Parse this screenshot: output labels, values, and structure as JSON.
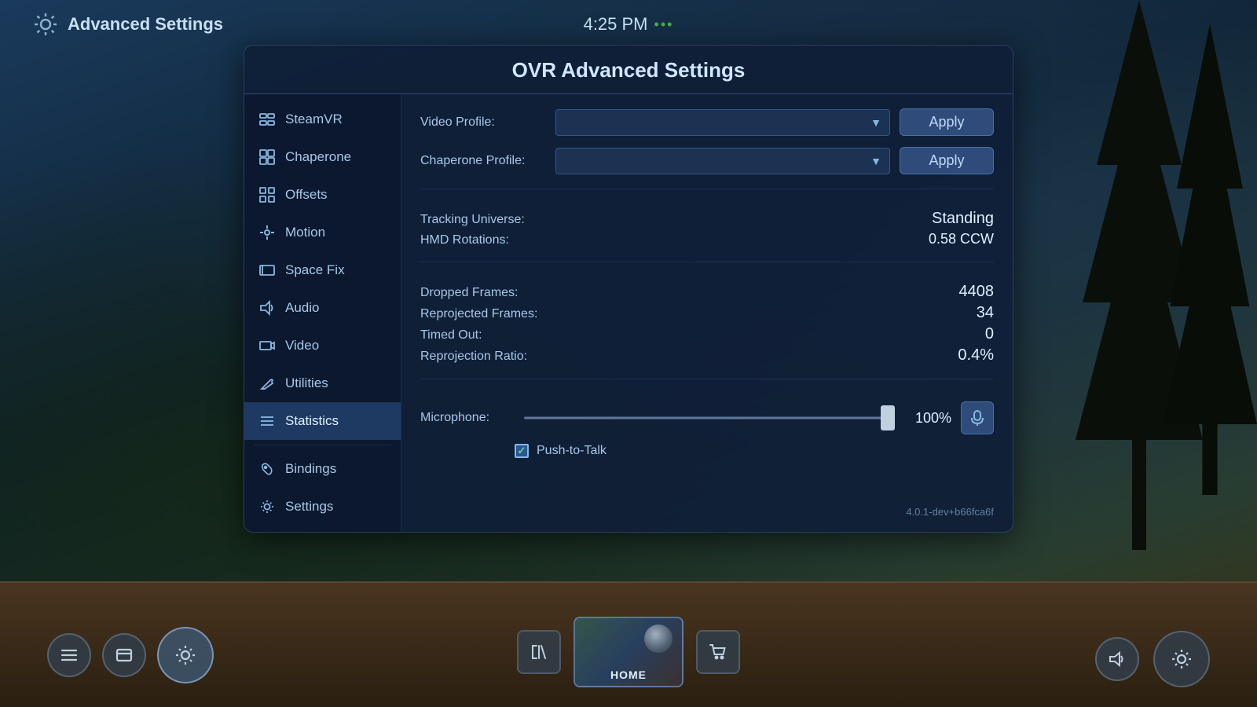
{
  "app": {
    "title": "Advanced Settings",
    "time": "4:25 PM",
    "dots": "•••"
  },
  "panel": {
    "title": "OVR Advanced Settings"
  },
  "sidebar": {
    "items": [
      {
        "id": "steamvr",
        "label": "SteamVR",
        "icon": "⚙"
      },
      {
        "id": "chaperone",
        "label": "Chaperone",
        "icon": "⊞"
      },
      {
        "id": "offsets",
        "label": "Offsets",
        "icon": "⊡"
      },
      {
        "id": "motion",
        "label": "Motion",
        "icon": "✛"
      },
      {
        "id": "space-fix",
        "label": "Space Fix",
        "icon": "▭"
      },
      {
        "id": "audio",
        "label": "Audio",
        "icon": "🔊"
      },
      {
        "id": "video",
        "label": "Video",
        "icon": "🖥"
      },
      {
        "id": "utilities",
        "label": "Utilities",
        "icon": "🔧"
      },
      {
        "id": "statistics",
        "label": "Statistics",
        "icon": "≡"
      }
    ],
    "bottom_items": [
      {
        "id": "bindings",
        "label": "Bindings",
        "icon": "✋"
      },
      {
        "id": "settings",
        "label": "Settings",
        "icon": "⚙"
      }
    ]
  },
  "content": {
    "video_profile_label": "Video Profile:",
    "video_profile_placeholder": "",
    "chaperone_profile_label": "Chaperone Profile:",
    "chaperone_profile_placeholder": "",
    "apply_label_1": "Apply",
    "apply_label_2": "Apply",
    "tracking_universe_label": "Tracking Universe:",
    "tracking_universe_value": "Standing",
    "hmd_rotations_label": "HMD Rotations:",
    "hmd_rotations_value": "0.58 CCW",
    "dropped_frames_label": "Dropped Frames:",
    "dropped_frames_value": "4408",
    "reprojected_frames_label": "Reprojected Frames:",
    "reprojected_frames_value": "34",
    "timed_out_label": "Timed Out:",
    "timed_out_value": "0",
    "reprojection_ratio_label": "Reprojection Ratio:",
    "reprojection_ratio_value": "0.4%",
    "microphone_label": "Microphone:",
    "microphone_percent": "100%",
    "push_to_talk_label": "Push-to-Talk",
    "version": "4.0.1-dev+b66fca6f"
  },
  "taskbar": {
    "menu_icon": "☰",
    "card_icon": "▬",
    "gear_icon": "⚙",
    "library_icon": "⫿",
    "home_label": "HOME",
    "cart_icon": "🛒",
    "volume_icon": "🔊",
    "settings_icon": "⚙"
  }
}
